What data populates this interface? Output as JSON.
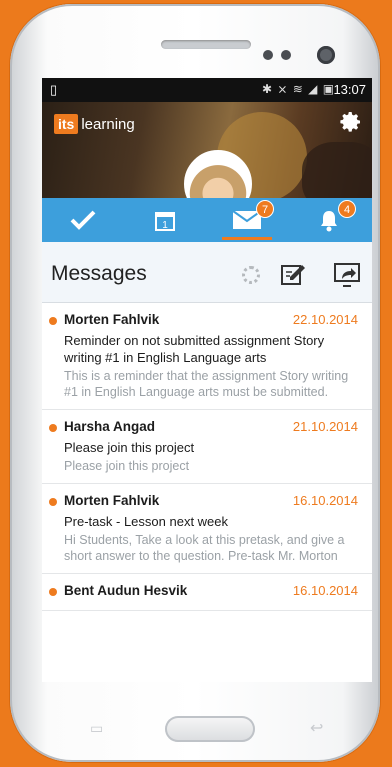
{
  "status_bar": {
    "left_icon": "sim-icon",
    "right_icons": "✱ ⨯ ≋ ◢ ▣",
    "time": "13:07"
  },
  "hero": {
    "logo_box": "its",
    "logo_text": "learning",
    "settings_icon": "gear-icon"
  },
  "tabs": [
    {
      "name": "tasks",
      "icon": "check-icon",
      "badge": ""
    },
    {
      "name": "calendar",
      "icon": "calendar-icon",
      "badge": ""
    },
    {
      "name": "messages",
      "icon": "envelope-icon",
      "badge": "7",
      "active": true
    },
    {
      "name": "notifications",
      "icon": "bell-icon",
      "badge": "4"
    }
  ],
  "header": {
    "title": "Messages"
  },
  "messages": [
    {
      "sender": "Morten Fahlvik",
      "date": "22.10.2014",
      "subject": "Reminder on not submitted assignment Story writing #1 in English Language arts",
      "preview": "This is a reminder that the assignment Story writing #1 in English Language arts must be submitted."
    },
    {
      "sender": "Harsha Angad",
      "date": "21.10.2014",
      "subject": "Please join this project",
      "preview": "Please join this project"
    },
    {
      "sender": "Morten Fahlvik",
      "date": "16.10.2014",
      "subject": "Pre-task - Lesson next week",
      "preview": "Hi Students,  Take a look at this pretask, and give a short answer to the question. Pre-task   Mr. Morton"
    },
    {
      "sender": "Bent Audun Hesvik",
      "date": "16.10.2014",
      "subject": "",
      "preview": ""
    }
  ],
  "colors": {
    "accent": "#ee7b1f",
    "tabbar": "#3d9fdc",
    "background": "#ec7a1c"
  }
}
